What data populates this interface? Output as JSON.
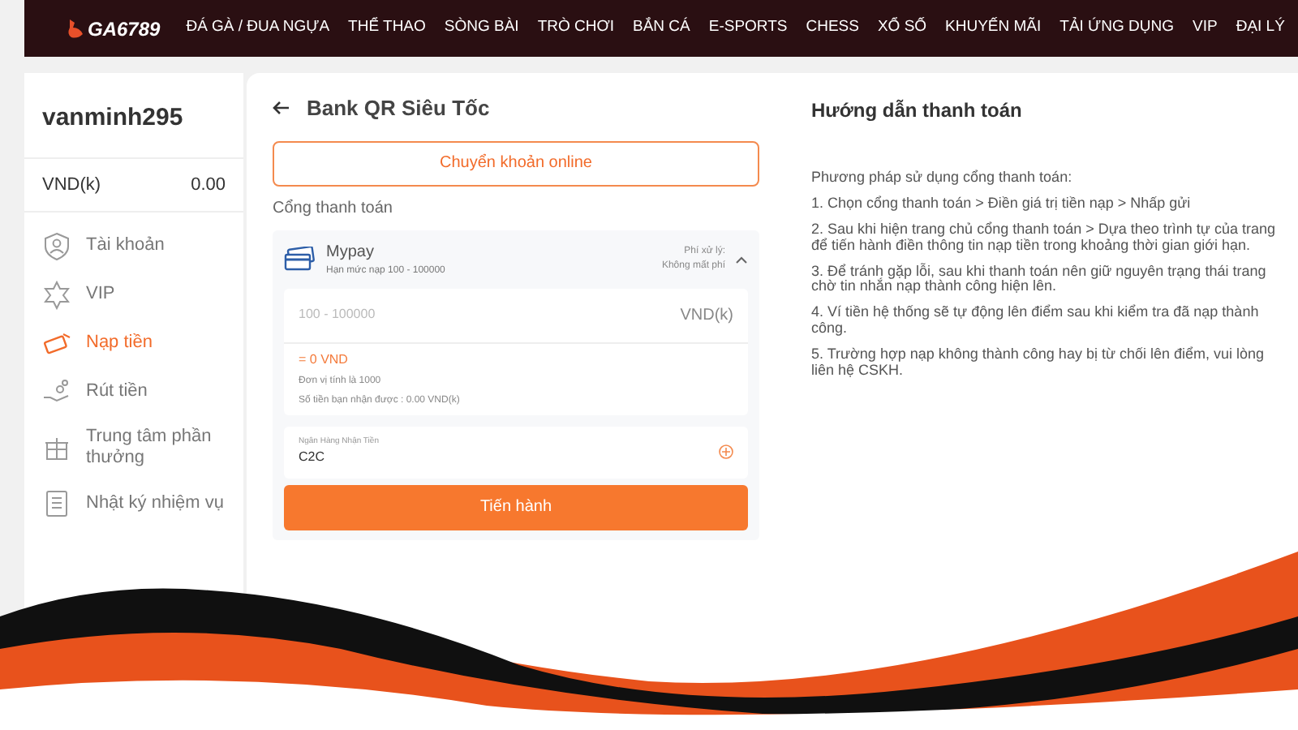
{
  "header": {
    "logo": "GA6789",
    "nav": [
      "ĐÁ GÀ / ĐUA NGỰA",
      "THỂ THAO",
      "SÒNG BÀI",
      "TRÒ CHƠI",
      "BẮN CÁ",
      "E-SPORTS",
      "CHESS",
      "XỔ SỐ",
      "KHUYẾN MÃI",
      "TẢI ỨNG DỤNG",
      "VIP",
      "ĐẠI LÝ"
    ]
  },
  "sidebar": {
    "username": "vanminh295",
    "balance_label": "VND(k)",
    "balance": "0.00",
    "items": [
      {
        "kind": "account",
        "label": "Tài khoản",
        "selected": false
      },
      {
        "kind": "vip",
        "label": "VIP",
        "selected": false
      },
      {
        "kind": "deposit",
        "label": "Nạp tiền",
        "selected": true
      },
      {
        "kind": "withdraw",
        "label": "Rút tiền",
        "selected": false
      },
      {
        "kind": "gift",
        "label": "Trung tâm phần thưởng",
        "selected": false
      },
      {
        "kind": "log",
        "label": "Nhật ký nhiệm vụ",
        "selected": false
      }
    ]
  },
  "deposit": {
    "title": "Bank QR Siêu Tốc",
    "method_button": "Chuyển khoản online",
    "gateway_label": "Cổng thanh toán",
    "gateway": {
      "name": "Mypay",
      "limit": "Hạn mức nạp 100 - 100000",
      "fee_label": "Phí xử lý:",
      "fee": "Không mất phí",
      "expanded": true
    },
    "amount": {
      "placeholder": "100 - 100000",
      "unit": "VND(k)"
    },
    "converted": "= 0 VND",
    "unit_note": "Đơn vị tính là 1000",
    "received": "Số tiền bạn nhận được : 0.00 VND(k)",
    "bank": {
      "label": "Ngân Hàng Nhận Tiền",
      "value": "C2C"
    },
    "submit": "Tiến hành"
  },
  "guide": {
    "title": "Hướng dẫn thanh toán",
    "intro": "Phương pháp sử dụng cổng thanh toán:",
    "steps": [
      "1. Chọn cổng thanh toán > Điền giá trị tiền nạp > Nhấp gửi",
      "2. Sau khi hiện trang chủ cổng thanh toán > Dựa theo trình tự của trang để tiến hành điền thông tin nạp tiền trong khoảng thời gian giới hạn.",
      "3. Để tránh gặp lỗi, sau khi thanh toán nên giữ nguyên trạng thái trang chờ tin nhắn nạp thành công hiện lên.",
      "4. Ví tiền hệ thống sẽ tự động lên điểm sau khi kiểm tra đã nạp thành công.",
      "5. Trường hợp nạp không thành công hay bị từ chối lên điểm, vui lòng liên hệ CSKH."
    ]
  }
}
